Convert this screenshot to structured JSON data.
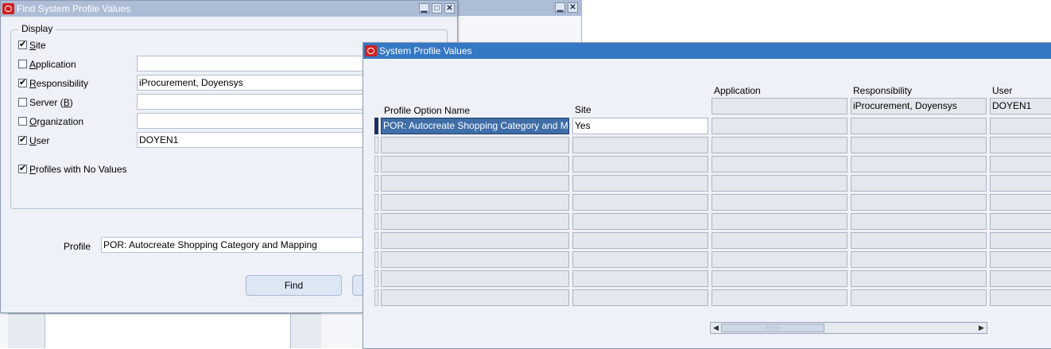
{
  "find_window": {
    "title": "Find System Profile Values",
    "display_group_label": "Display",
    "checkboxes": [
      {
        "label_pre": "",
        "label_key": "S",
        "label_post": "ite",
        "checked": true
      },
      {
        "label_pre": "",
        "label_key": "A",
        "label_post": "pplication",
        "checked": false
      },
      {
        "label_pre": "",
        "label_key": "R",
        "label_post": "esponsibility",
        "checked": true
      },
      {
        "label_pre": "Server (",
        "label_key": "B",
        "label_post": ")",
        "checked": false
      },
      {
        "label_pre": "",
        "label_key": "O",
        "label_post": "rganization",
        "checked": false
      },
      {
        "label_pre": "",
        "label_key": "U",
        "label_post": "ser",
        "checked": true
      }
    ],
    "fields": {
      "application": "",
      "responsibility": "iProcurement, Doyensys",
      "server": "",
      "organization": "",
      "user": "DOYEN1"
    },
    "profiles_no_values": {
      "label_key": "P",
      "label_post": "rofiles with No Values",
      "checked": true
    },
    "profile_label": "Profile",
    "profile_value": "POR: Autocreate Shopping Category and Mapping",
    "find_button": "Find"
  },
  "back_window": {
    "controls": [
      "minimize",
      "close"
    ]
  },
  "values_window": {
    "title": "System Profile Values",
    "headers": {
      "profile_option_name": "Profile Option Name",
      "site": "Site",
      "application": "Application",
      "responsibility": "Responsibility",
      "user": "User"
    },
    "context": {
      "application": "",
      "responsibility": "iProcurement, Doyensys",
      "user": "DOYEN1"
    },
    "rows": [
      {
        "profile_option_name": "POR: Autocreate Shopping Category and Mapping",
        "site": "Yes",
        "application": "",
        "responsibility": "",
        "user": ""
      },
      {
        "profile_option_name": "",
        "site": "",
        "application": "",
        "responsibility": "",
        "user": ""
      },
      {
        "profile_option_name": "",
        "site": "",
        "application": "",
        "responsibility": "",
        "user": ""
      },
      {
        "profile_option_name": "",
        "site": "",
        "application": "",
        "responsibility": "",
        "user": ""
      },
      {
        "profile_option_name": "",
        "site": "",
        "application": "",
        "responsibility": "",
        "user": ""
      },
      {
        "profile_option_name": "",
        "site": "",
        "application": "",
        "responsibility": "",
        "user": ""
      },
      {
        "profile_option_name": "",
        "site": "",
        "application": "",
        "responsibility": "",
        "user": ""
      },
      {
        "profile_option_name": "",
        "site": "",
        "application": "",
        "responsibility": "",
        "user": ""
      },
      {
        "profile_option_name": "",
        "site": "",
        "application": "",
        "responsibility": "",
        "user": ""
      },
      {
        "profile_option_name": "",
        "site": "",
        "application": "",
        "responsibility": "",
        "user": ""
      }
    ]
  },
  "colors": {
    "title_active": "#3478c4",
    "title_inactive": "#aebdd6",
    "selection": "#3f6ea8",
    "oracle_red": "#d11f1f"
  }
}
